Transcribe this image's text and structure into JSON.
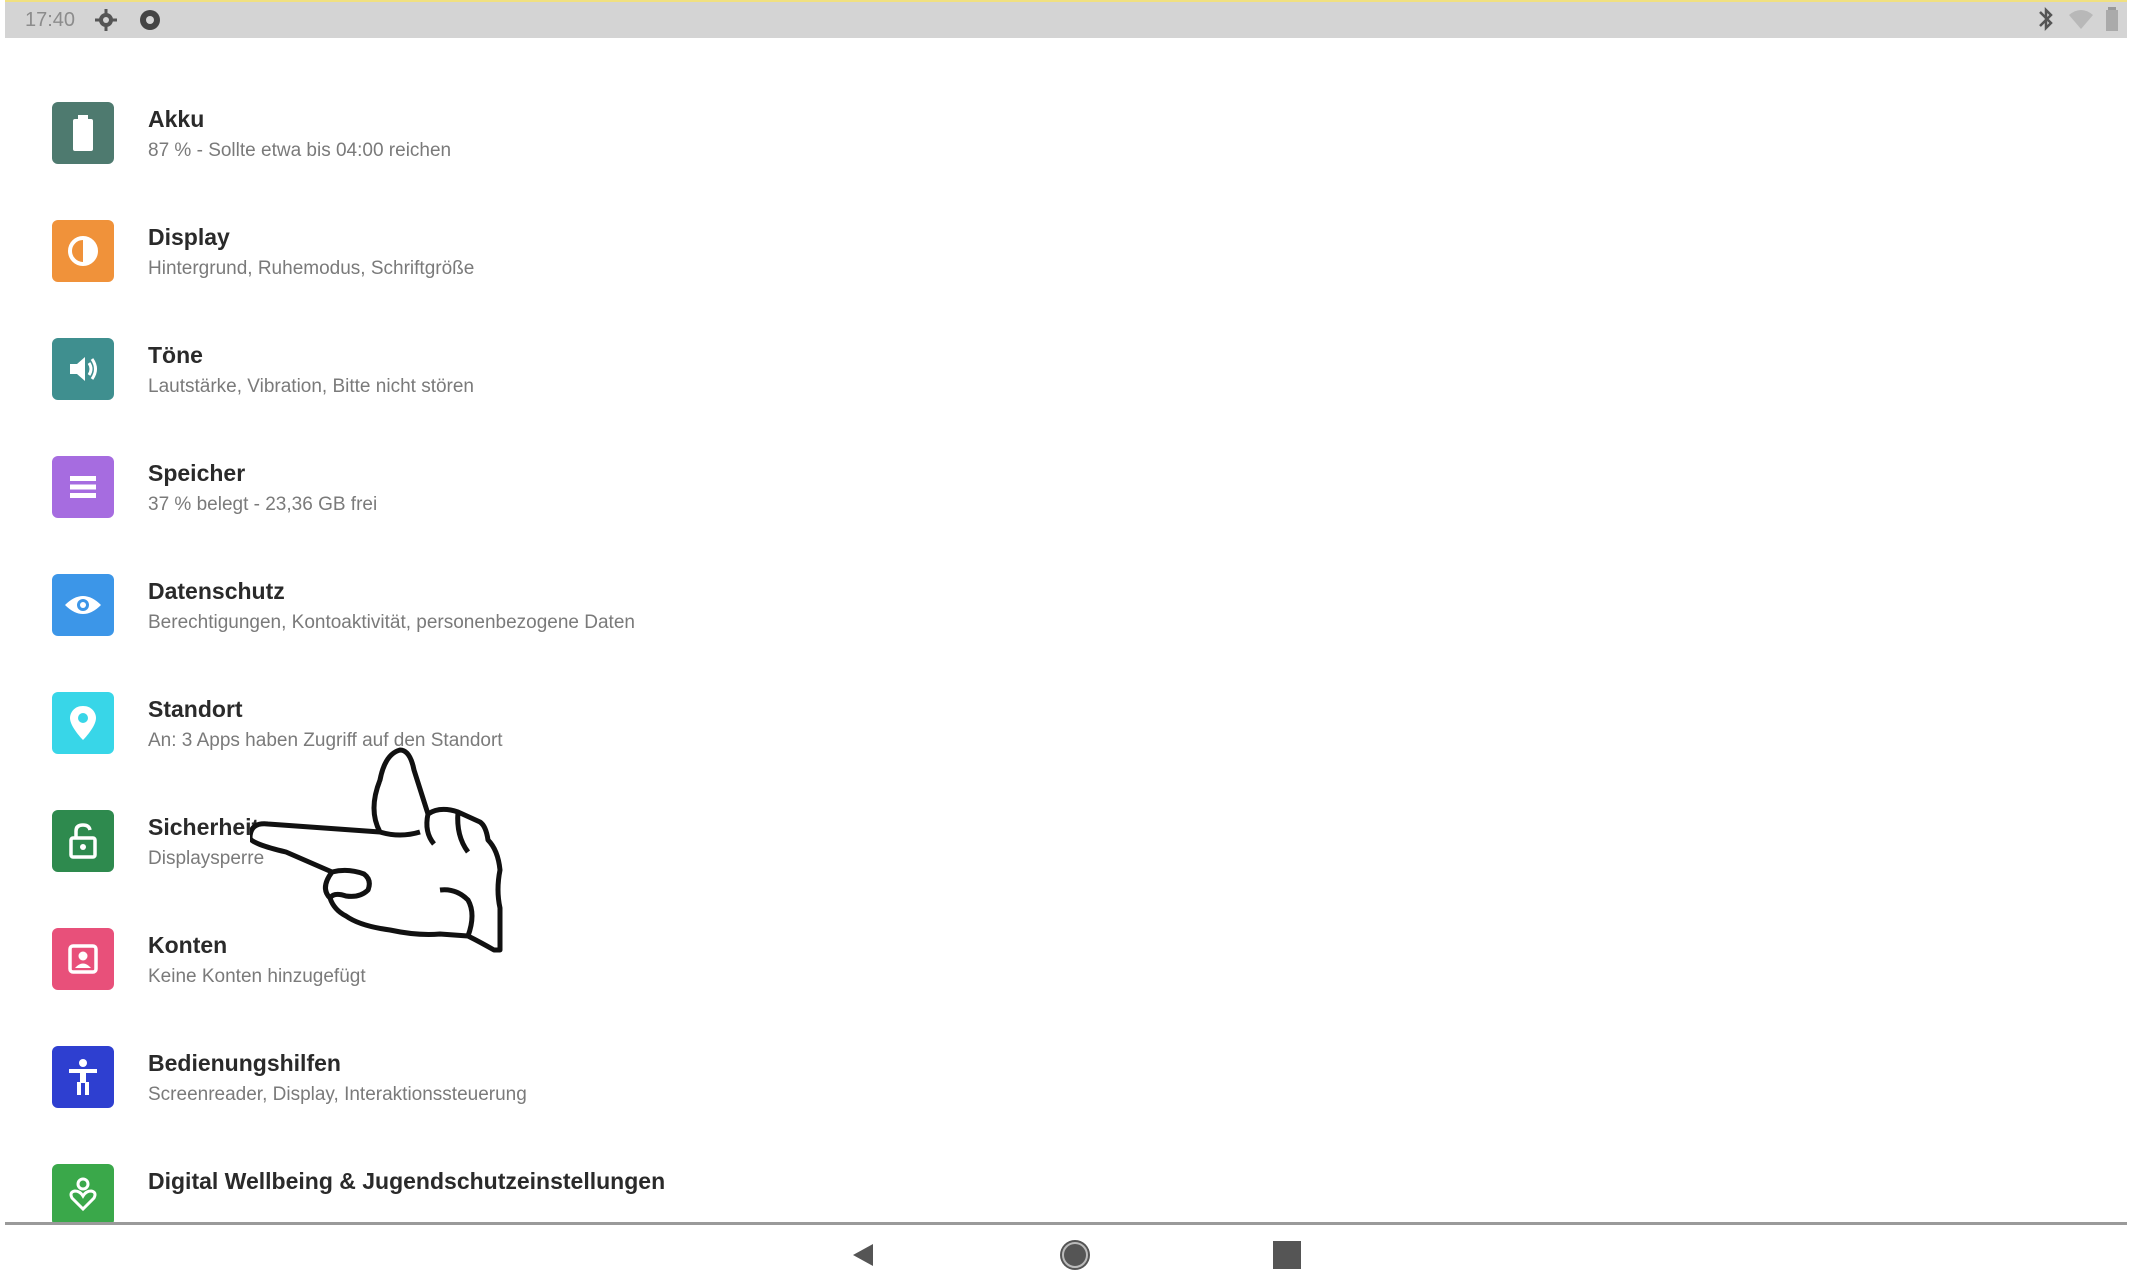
{
  "status_bar": {
    "time": "17:40",
    "icons": [
      "settings-gear-icon",
      "shield-icon"
    ],
    "right_icons": [
      "bluetooth-icon",
      "wifi-icon",
      "battery-icon"
    ]
  },
  "settings": [
    {
      "title": "Akku",
      "subtitle": "87 % - Sollte etwa bis 04:00 reichen",
      "icon": "battery-icon",
      "color": "#4e7a6f"
    },
    {
      "title": "Display",
      "subtitle": "Hintergrund, Ruhemodus, Schriftgröße",
      "icon": "display-icon",
      "color": "#f0923a"
    },
    {
      "title": "Töne",
      "subtitle": "Lautstärke, Vibration, Bitte nicht stören",
      "icon": "volume-icon",
      "color": "#3f8f8f"
    },
    {
      "title": "Speicher",
      "subtitle": "37 % belegt - 23,36 GB frei",
      "icon": "storage-icon",
      "color": "#a66ce0"
    },
    {
      "title": "Datenschutz",
      "subtitle": "Berechtigungen, Kontoaktivität, personenbezogene Daten",
      "icon": "privacy-icon",
      "color": "#3c96e8"
    },
    {
      "title": "Standort",
      "subtitle": "An: 3 Apps haben Zugriff auf den Standort",
      "icon": "location-icon",
      "color": "#38d6e8"
    },
    {
      "title": "Sicherheit",
      "subtitle": "Displaysperre",
      "icon": "lock-icon",
      "color": "#2e8a4e"
    },
    {
      "title": "Konten",
      "subtitle": "Keine Konten hinzugefügt",
      "icon": "account-icon",
      "color": "#e8507a"
    },
    {
      "title": "Bedienungshilfen",
      "subtitle": "Screenreader, Display, Interaktionssteuerung",
      "icon": "accessibility-icon",
      "color": "#2e3fd0"
    },
    {
      "title": "Digital Wellbeing & Jugendschutzeinstellungen",
      "subtitle": "",
      "icon": "wellbeing-icon",
      "color": "#3aa84a"
    }
  ],
  "nav_bar": {
    "back": "back-icon",
    "home": "home-icon",
    "recents": "recents-icon"
  }
}
